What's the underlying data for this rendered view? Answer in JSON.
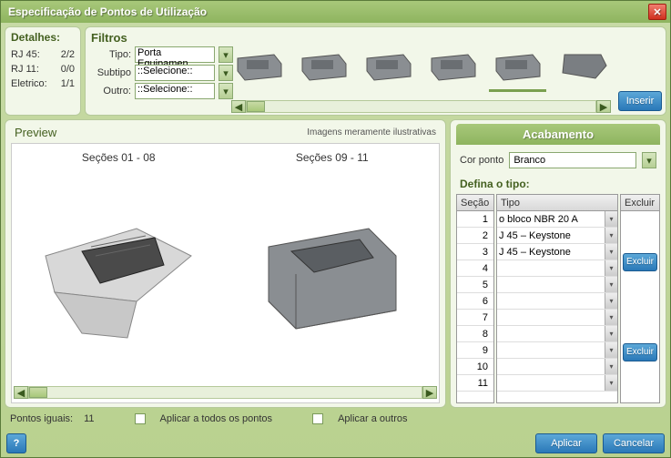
{
  "window": {
    "title": "Especificação de Pontos de Utilização"
  },
  "detalhes": {
    "heading": "Detalhes:",
    "rows": [
      {
        "label": "RJ 45:",
        "value": "2/2"
      },
      {
        "label": "RJ 11:",
        "value": "0/0"
      },
      {
        "label": "Eletrico:",
        "value": "1/1"
      }
    ]
  },
  "filtros": {
    "heading": "Filtros",
    "tipo_label": "Tipo:",
    "tipo_value": "Porta Equipamen",
    "subtipo_label": "Subtipo",
    "subtipo_value": "::Selecione::",
    "outro_label": "Outro:",
    "outro_value": "::Selecione::",
    "inserir": "Inserir"
  },
  "preview": {
    "heading": "Preview",
    "note": "Imagens meramente ilustrativas",
    "sec1": "Seções 01 - 08",
    "sec2": "Seções 09 - 11"
  },
  "acabamento": {
    "heading": "Acabamento",
    "cor_label": "Cor ponto",
    "cor_value": "Branco",
    "defina": "Defina o tipo:",
    "col_secao": "Seção",
    "col_tipo": "Tipo",
    "col_excluir": "Excluir",
    "excluir_btn": "Excluir",
    "rows": [
      {
        "secao": "1",
        "tipo": "o bloco NBR 20 A"
      },
      {
        "secao": "2",
        "tipo": "J 45 – Keystone"
      },
      {
        "secao": "3",
        "tipo": "J 45 – Keystone"
      },
      {
        "secao": "4",
        "tipo": ""
      },
      {
        "secao": "5",
        "tipo": ""
      },
      {
        "secao": "6",
        "tipo": ""
      },
      {
        "secao": "7",
        "tipo": ""
      },
      {
        "secao": "8",
        "tipo": ""
      },
      {
        "secao": "9",
        "tipo": ""
      },
      {
        "secao": "10",
        "tipo": ""
      },
      {
        "secao": "11",
        "tipo": ""
      }
    ]
  },
  "bottom": {
    "pontos_label": "Pontos iguais:",
    "pontos_value": "11",
    "aplicar_todos": "Aplicar a todos os pontos",
    "aplicar_outros": "Aplicar a outros"
  },
  "footer": {
    "help": "?",
    "aplicar": "Aplicar",
    "cancelar": "Cancelar"
  }
}
